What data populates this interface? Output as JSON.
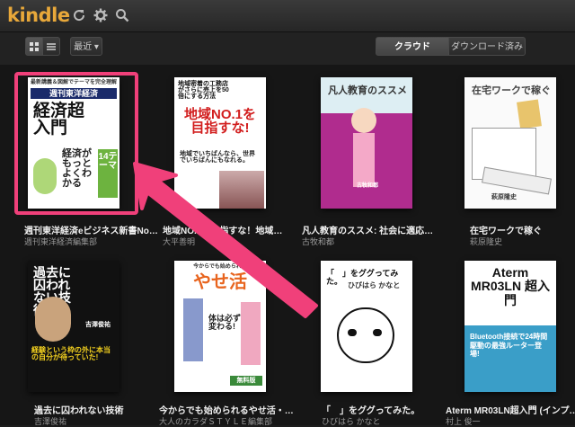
{
  "app": {
    "logo": "kindle"
  },
  "toolbar": {
    "sort_label": "最近",
    "tabs": [
      "クラウド",
      "ダウンロード済み"
    ]
  },
  "books": [
    {
      "title": "週刊東洋経済eビジネス新書No…",
      "author": "週刊東洋経済編集部",
      "cover": {
        "top": "最新講義＆図解でテーマを完全理解",
        "brand": "週刊東洋経済",
        "main": "経済超入門",
        "sub": "経済がもっとよくわかる",
        "num": "14テーマ"
      }
    },
    {
      "title": "地域NO.1を目指すな！地域…",
      "author": "大平善明",
      "cover": {
        "top": "地域密着の工務店がさらに売上を50倍にする方法",
        "main": "地域NO.1を目指すな!",
        "sub": "地域でいちばんなら、世界でいちばんにもなれる。"
      }
    },
    {
      "title": "凡人教育のススメ: 社会に適応…",
      "author": "古牧和都",
      "cover": {
        "main": "凡人教育のススメ",
        "sub": "古牧和都"
      }
    },
    {
      "title": "在宅ワークで稼ぐ",
      "author": "萩原隆史",
      "cover": {
        "main": "在宅ワークで稼ぐ",
        "sub": "萩原隆史"
      }
    },
    {
      "title": "過去に囚われない技術",
      "author": "吉澤俊祐",
      "cover": {
        "main": "過去に囚われない技術",
        "sub": "経験という枠の外に本当の自分が待っていた!",
        "author": "吉澤俊祐"
      }
    },
    {
      "title": "今からでも始められるやせ活・…",
      "author": "大人のカラダＳＴＹＬＥ編集部",
      "cover": {
        "top": "今からでも始められる",
        "main": "やせ活",
        "sub": "体は必ず変わる!",
        "badge": "無料版"
      }
    },
    {
      "title": "「　」をググってみた。",
      "author": "ひびはら かなと",
      "cover": {
        "main": "「　」をググってみた。",
        "sub": "ひびはら かなと"
      }
    },
    {
      "title": "Aterm MR03LN超入門 (インプ…",
      "author": "村上 俊一",
      "cover": {
        "main": "Aterm MR03LN 超入門",
        "sub": "Bluetooth接続で24時間駆動の最強ルーター登場!"
      }
    }
  ],
  "colors": {
    "accent": "#e8a83a",
    "highlight": "#f0407a"
  }
}
